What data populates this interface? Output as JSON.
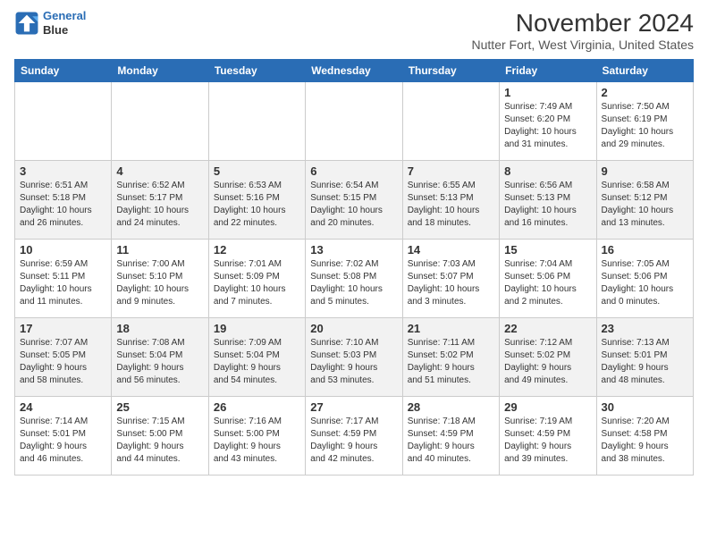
{
  "header": {
    "logo_line1": "General",
    "logo_line2": "Blue",
    "main_title": "November 2024",
    "subtitle": "Nutter Fort, West Virginia, United States"
  },
  "days_of_week": [
    "Sunday",
    "Monday",
    "Tuesday",
    "Wednesday",
    "Thursday",
    "Friday",
    "Saturday"
  ],
  "weeks": [
    [
      {
        "day": "",
        "info": ""
      },
      {
        "day": "",
        "info": ""
      },
      {
        "day": "",
        "info": ""
      },
      {
        "day": "",
        "info": ""
      },
      {
        "day": "",
        "info": ""
      },
      {
        "day": "1",
        "info": "Sunrise: 7:49 AM\nSunset: 6:20 PM\nDaylight: 10 hours\nand 31 minutes."
      },
      {
        "day": "2",
        "info": "Sunrise: 7:50 AM\nSunset: 6:19 PM\nDaylight: 10 hours\nand 29 minutes."
      }
    ],
    [
      {
        "day": "3",
        "info": "Sunrise: 6:51 AM\nSunset: 5:18 PM\nDaylight: 10 hours\nand 26 minutes."
      },
      {
        "day": "4",
        "info": "Sunrise: 6:52 AM\nSunset: 5:17 PM\nDaylight: 10 hours\nand 24 minutes."
      },
      {
        "day": "5",
        "info": "Sunrise: 6:53 AM\nSunset: 5:16 PM\nDaylight: 10 hours\nand 22 minutes."
      },
      {
        "day": "6",
        "info": "Sunrise: 6:54 AM\nSunset: 5:15 PM\nDaylight: 10 hours\nand 20 minutes."
      },
      {
        "day": "7",
        "info": "Sunrise: 6:55 AM\nSunset: 5:13 PM\nDaylight: 10 hours\nand 18 minutes."
      },
      {
        "day": "8",
        "info": "Sunrise: 6:56 AM\nSunset: 5:13 PM\nDaylight: 10 hours\nand 16 minutes."
      },
      {
        "day": "9",
        "info": "Sunrise: 6:58 AM\nSunset: 5:12 PM\nDaylight: 10 hours\nand 13 minutes."
      }
    ],
    [
      {
        "day": "10",
        "info": "Sunrise: 6:59 AM\nSunset: 5:11 PM\nDaylight: 10 hours\nand 11 minutes."
      },
      {
        "day": "11",
        "info": "Sunrise: 7:00 AM\nSunset: 5:10 PM\nDaylight: 10 hours\nand 9 minutes."
      },
      {
        "day": "12",
        "info": "Sunrise: 7:01 AM\nSunset: 5:09 PM\nDaylight: 10 hours\nand 7 minutes."
      },
      {
        "day": "13",
        "info": "Sunrise: 7:02 AM\nSunset: 5:08 PM\nDaylight: 10 hours\nand 5 minutes."
      },
      {
        "day": "14",
        "info": "Sunrise: 7:03 AM\nSunset: 5:07 PM\nDaylight: 10 hours\nand 3 minutes."
      },
      {
        "day": "15",
        "info": "Sunrise: 7:04 AM\nSunset: 5:06 PM\nDaylight: 10 hours\nand 2 minutes."
      },
      {
        "day": "16",
        "info": "Sunrise: 7:05 AM\nSunset: 5:06 PM\nDaylight: 10 hours\nand 0 minutes."
      }
    ],
    [
      {
        "day": "17",
        "info": "Sunrise: 7:07 AM\nSunset: 5:05 PM\nDaylight: 9 hours\nand 58 minutes."
      },
      {
        "day": "18",
        "info": "Sunrise: 7:08 AM\nSunset: 5:04 PM\nDaylight: 9 hours\nand 56 minutes."
      },
      {
        "day": "19",
        "info": "Sunrise: 7:09 AM\nSunset: 5:04 PM\nDaylight: 9 hours\nand 54 minutes."
      },
      {
        "day": "20",
        "info": "Sunrise: 7:10 AM\nSunset: 5:03 PM\nDaylight: 9 hours\nand 53 minutes."
      },
      {
        "day": "21",
        "info": "Sunrise: 7:11 AM\nSunset: 5:02 PM\nDaylight: 9 hours\nand 51 minutes."
      },
      {
        "day": "22",
        "info": "Sunrise: 7:12 AM\nSunset: 5:02 PM\nDaylight: 9 hours\nand 49 minutes."
      },
      {
        "day": "23",
        "info": "Sunrise: 7:13 AM\nSunset: 5:01 PM\nDaylight: 9 hours\nand 48 minutes."
      }
    ],
    [
      {
        "day": "24",
        "info": "Sunrise: 7:14 AM\nSunset: 5:01 PM\nDaylight: 9 hours\nand 46 minutes."
      },
      {
        "day": "25",
        "info": "Sunrise: 7:15 AM\nSunset: 5:00 PM\nDaylight: 9 hours\nand 44 minutes."
      },
      {
        "day": "26",
        "info": "Sunrise: 7:16 AM\nSunset: 5:00 PM\nDaylight: 9 hours\nand 43 minutes."
      },
      {
        "day": "27",
        "info": "Sunrise: 7:17 AM\nSunset: 4:59 PM\nDaylight: 9 hours\nand 42 minutes."
      },
      {
        "day": "28",
        "info": "Sunrise: 7:18 AM\nSunset: 4:59 PM\nDaylight: 9 hours\nand 40 minutes."
      },
      {
        "day": "29",
        "info": "Sunrise: 7:19 AM\nSunset: 4:59 PM\nDaylight: 9 hours\nand 39 minutes."
      },
      {
        "day": "30",
        "info": "Sunrise: 7:20 AM\nSunset: 4:58 PM\nDaylight: 9 hours\nand 38 minutes."
      }
    ]
  ]
}
